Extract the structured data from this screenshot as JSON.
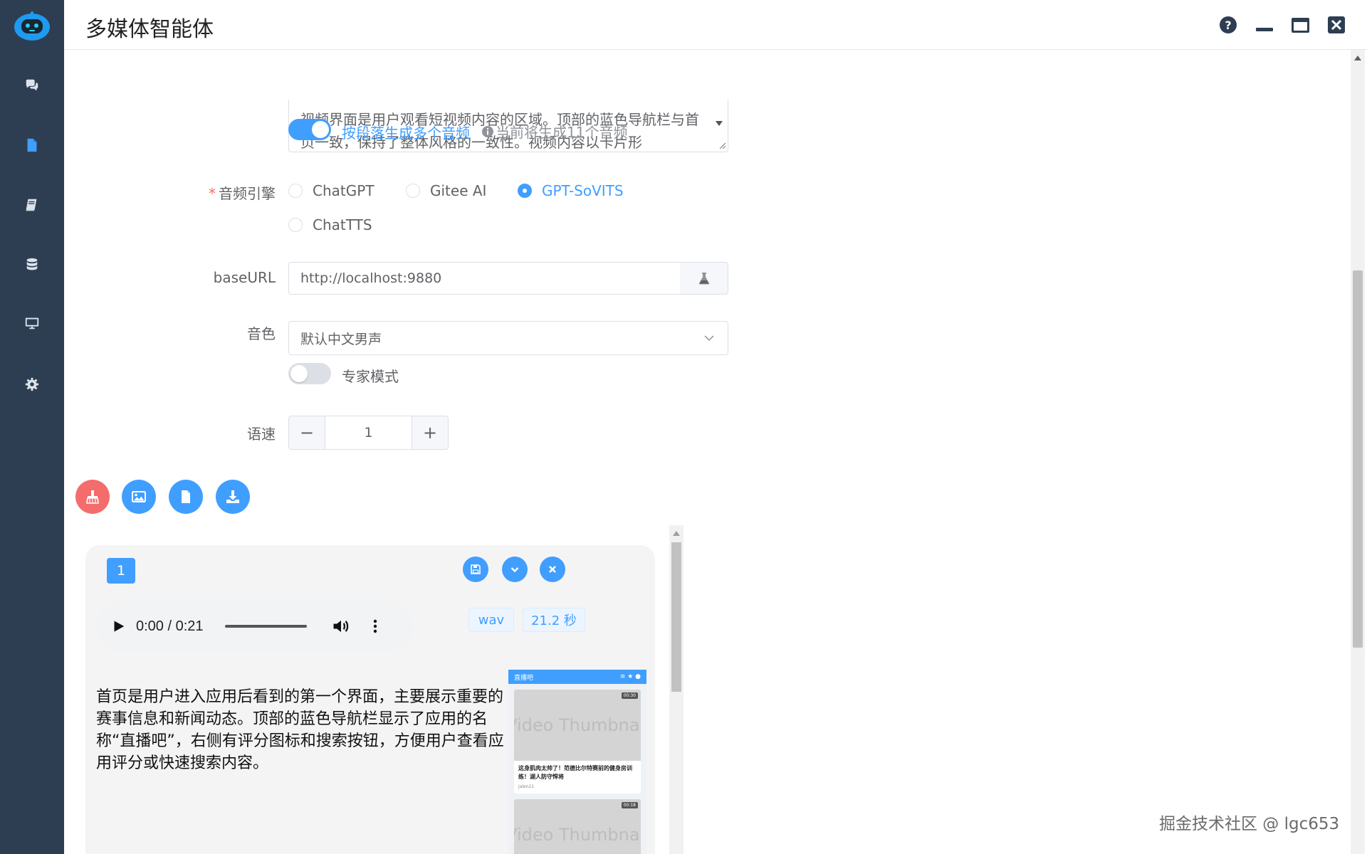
{
  "app": {
    "title": "多媒体智能体"
  },
  "sidebar": {
    "items": [
      {
        "icon": "chat-icon"
      },
      {
        "icon": "file-icon",
        "active": true
      },
      {
        "icon": "book-icon"
      },
      {
        "icon": "database-icon"
      },
      {
        "icon": "monitor-icon"
      },
      {
        "icon": "gear-icon"
      }
    ]
  },
  "form": {
    "textarea_text": "视频界面是用户观看短视频内容的区域。顶部的蓝色导航栏与首页一致，保持了整体风格的一致性。视频内容以卡片形",
    "split_toggle_label": "按段落生成多个音频",
    "split_hint": "当前将生成11个音频",
    "engine_label": "音频引擎",
    "engine_options": [
      "ChatGPT",
      "Gitee AI",
      "GPT-SoVITS",
      "ChatTTS"
    ],
    "engine_selected": "GPT-SoVITS",
    "baseurl_label": "baseURL",
    "baseurl_value": "http://localhost:9880",
    "voice_label": "音色",
    "voice_value": "默认中文男声",
    "expert_label": "专家模式",
    "speed_label": "语速",
    "speed_value": "1",
    "speed_minus": "−",
    "speed_plus": "+"
  },
  "card": {
    "index": "1",
    "audio_time": "0:00 / 0:21",
    "format_tag": "wav",
    "duration_tag": "21.2 秒",
    "description": "首页是用户进入应用后看到的第一个界面，主要展示重要的赛事信息和新闻动态。顶部的蓝色导航栏显示了应用的名称“直播吧”，右侧有评分图标和搜索按钮，方便用户查看应用评分或快速搜索内容。",
    "thumbnail": {
      "header_title": "直播吧",
      "thumb_label": "Video Thumbnail",
      "dur1": "00:30",
      "dur2": "00:18",
      "caption": "这身肌肉太帅了！范德比尔特赛前的健身房训练！湖人防守悍将",
      "author": "jalen21"
    }
  },
  "watermark": "掘金技术社区 @ lgc653",
  "colors": {
    "accent": "#409eff",
    "sidebar": "#2e3e52",
    "danger": "#f56c6c"
  }
}
